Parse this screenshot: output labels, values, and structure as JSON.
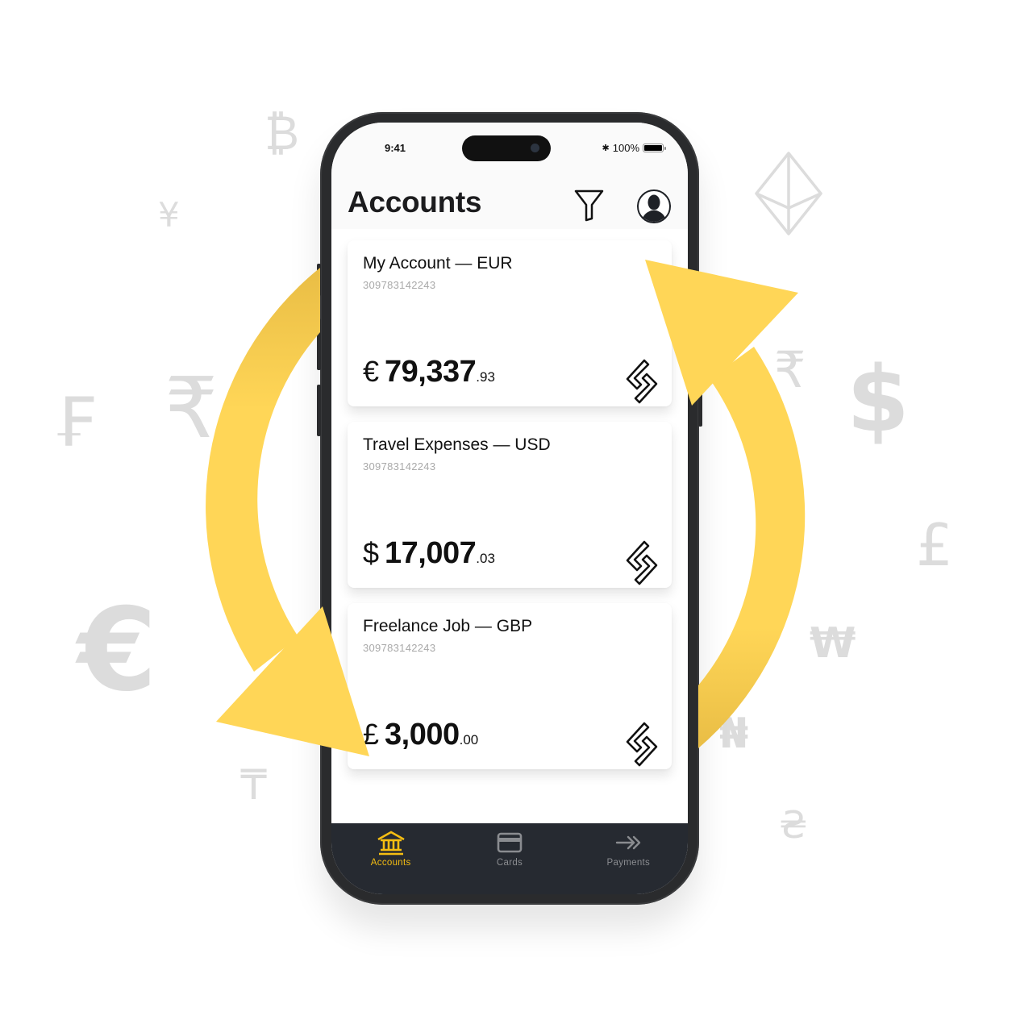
{
  "background_symbols": [
    {
      "glyph": "₿",
      "name": "bitcoin-symbol"
    },
    {
      "glyph": "¥",
      "name": "yen-symbol"
    },
    {
      "glyph": "₣",
      "name": "franc-symbol"
    },
    {
      "glyph": "₹",
      "name": "rupee-symbol-left"
    },
    {
      "glyph": "€",
      "name": "euro-symbol"
    },
    {
      "glyph": "₸",
      "name": "tenge-symbol"
    },
    {
      "glyph": "₹",
      "name": "rupee-symbol-right"
    },
    {
      "glyph": "$",
      "name": "dollar-symbol"
    },
    {
      "glyph": "£",
      "name": "pound-symbol"
    },
    {
      "glyph": "₩",
      "name": "won-symbol"
    },
    {
      "glyph": "₦",
      "name": "naira-symbol"
    },
    {
      "glyph": "₴",
      "name": "hryvnia-symbol"
    }
  ],
  "ethereum_icon": "ethereum-icon",
  "colors": {
    "accent": "#f5bd12",
    "arrow": "#ffd657",
    "arrow_shade": "#e9bd45",
    "tabbar_bg": "#262a31",
    "symbol_gray": "#dcdcdc",
    "inactive_tab": "#8a8c90"
  },
  "status_bar": {
    "time": "9:41",
    "bluetooth": "✱",
    "battery_percent": "100%",
    "battery_level": 1.0
  },
  "header": {
    "title": "Accounts",
    "filter_icon": "filter-icon",
    "profile_icon": "profile-avatar-icon"
  },
  "accounts": [
    {
      "title": "My Account — EUR",
      "number": "309783142243",
      "currency_symbol": "€",
      "balance_whole": "79,337",
      "balance_cents": ".93"
    },
    {
      "title": "Travel Expenses — USD",
      "number": "309783142243",
      "currency_symbol": "$",
      "balance_whole": "17,007",
      "balance_cents": ".03"
    },
    {
      "title": "Freelance Job — GBP",
      "number": "309783142243",
      "currency_symbol": "£",
      "balance_whole": "3,000",
      "balance_cents": ".00"
    }
  ],
  "tabbar": {
    "items": [
      {
        "label": "Accounts",
        "icon": "bank-icon",
        "active": true
      },
      {
        "label": "Cards",
        "icon": "card-icon",
        "active": false
      },
      {
        "label": "Payments",
        "icon": "double-arrow-icon",
        "active": false
      }
    ]
  }
}
